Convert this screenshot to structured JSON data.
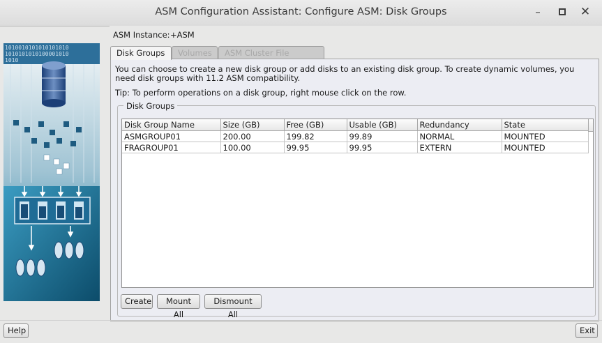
{
  "window": {
    "title": "ASM Configuration Assistant: Configure ASM: Disk Groups",
    "controls": [
      "minimize",
      "maximize",
      "close"
    ]
  },
  "instance": {
    "label": "ASM Instance:",
    "value": "+ASM"
  },
  "tabs": [
    {
      "label": "Disk Groups",
      "active": true
    },
    {
      "label": "Volumes",
      "active": false
    },
    {
      "label": "ASM Cluster File Systems",
      "active": false
    }
  ],
  "panel": {
    "description": "You can choose to create a new disk group or add disks to an existing disk group. To create dynamic volumes, you need disk groups with 11.2 ASM compatibility.",
    "tip": "Tip: To perform operations on a disk group, right mouse click on the row.",
    "group_title": "Disk Groups"
  },
  "table": {
    "columns": [
      "Disk Group Name",
      "Size (GB)",
      "Free (GB)",
      "Usable (GB)",
      "Redundancy",
      "State"
    ],
    "rows": [
      [
        "ASMGROUP01",
        "200.00",
        "199.82",
        "99.89",
        "NORMAL",
        "MOUNTED"
      ],
      [
        "FRAGROUP01",
        "100.00",
        "99.95",
        "99.95",
        "EXTERN",
        "MOUNTED"
      ]
    ]
  },
  "actions": {
    "create": "Create",
    "mount_all": "Mount All",
    "dismount_all": "Dismount All"
  },
  "footer": {
    "help": "Help",
    "exit": "Exit"
  },
  "art": {
    "binary_text": "1010010101010101010\n1010101010100001010\n1010"
  }
}
